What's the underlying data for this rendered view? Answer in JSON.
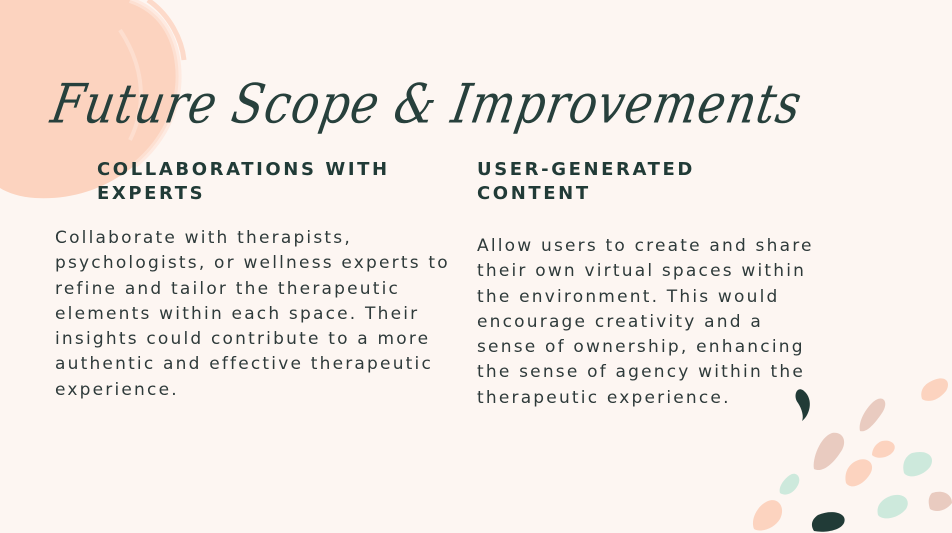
{
  "title": "Future Scope & Improvements",
  "columns": [
    {
      "heading": "COLLABORATIONS WITH EXPERTS",
      "body": "Collaborate with therapists, psychologists, or wellness experts to refine and tailor the therapeutic elements within each space. Their insights could contribute to a more authentic and effective therapeutic experience."
    },
    {
      "heading": "USER-GENERATED CONTENT",
      "body": "Allow users to create and share their own virtual spaces within the environment. This would encourage creativity and a sense of ownership, enhancing the sense of agency within the therapeutic experience."
    }
  ],
  "colors": {
    "background": "#fdf6f2",
    "peach": "#fcd3bf",
    "dark_green": "#213b37",
    "mint": "#cde9dc",
    "rose": "#e9cbc0"
  }
}
